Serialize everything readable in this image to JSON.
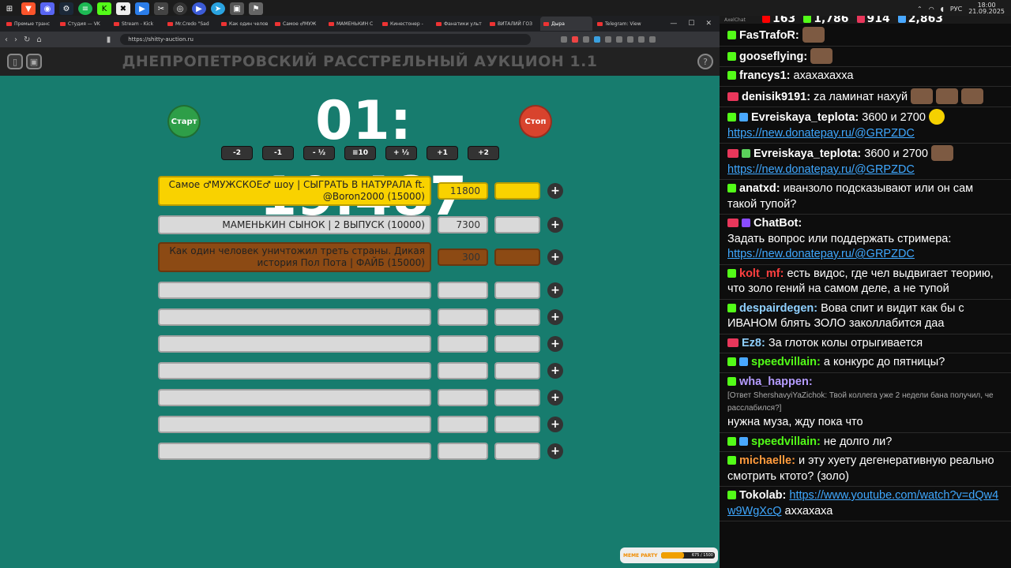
{
  "taskbar": {
    "lang": "РУС",
    "time": "18:00",
    "date": "21.09.2025"
  },
  "browser": {
    "tabs": [
      {
        "label": "Премые транс"
      },
      {
        "label": "Студия — VK"
      },
      {
        "label": "Stream - Kick"
      },
      {
        "label": "Mr.Credo \"Sad"
      },
      {
        "label": "Как один челов"
      },
      {
        "label": "Самое ♂МУЖ"
      },
      {
        "label": "МАМЕНЬКИН С"
      },
      {
        "label": "Кинестонер -"
      },
      {
        "label": "Фанатики ульт"
      },
      {
        "label": "ВИТАЛИЙ ГОЗ"
      },
      {
        "label": "Дыра",
        "active": true
      },
      {
        "label": "Telegram: View"
      }
    ],
    "url": "https://shitty-auction.ru"
  },
  "auction": {
    "title": "ДНЕПРОПЕТРОВСКИЙ РАССТРЕЛЬНЫЙ АУКЦИОН 1.1",
    "start_label": "Старт",
    "stop_label": "Стоп",
    "timer": "01: 19.487",
    "help": "?",
    "adjust": [
      "-2",
      "-1",
      "- ½",
      "≡10",
      "+ ½",
      "+1",
      "+2"
    ],
    "lots": [
      {
        "name": "Самое ♂МУЖСКОЕ♂ шоу | СЫГРАТЬ В НАТУРАЛА ft. @Boron2000 (15000)",
        "amount": "11800",
        "color": "yellow"
      },
      {
        "name": "МАМЕНЬКИН СЫНОК | 2 ВЫПУСК (10000)",
        "amount": "7300",
        "color": "gray"
      },
      {
        "name": "Как один человек уничтожил треть страны. Дикая история Пол Пота | ФАЙБ (15000)",
        "amount": "300",
        "color": "brown"
      },
      {
        "name": "",
        "amount": "",
        "color": "gray"
      },
      {
        "name": "",
        "amount": "",
        "color": "gray"
      },
      {
        "name": "",
        "amount": "",
        "color": "gray"
      },
      {
        "name": "",
        "amount": "",
        "color": "gray"
      },
      {
        "name": "",
        "amount": "",
        "color": "gray"
      },
      {
        "name": "",
        "amount": "",
        "color": "gray"
      },
      {
        "name": "",
        "amount": "",
        "color": "gray"
      }
    ],
    "plus_label": "+"
  },
  "widget": {
    "label": "MEME PARTY",
    "progress_text": "675 / 1500",
    "progress_fraction": 0.45
  },
  "chat": {
    "app_name": "AxelChat",
    "stats": [
      {
        "value": "163",
        "color": "#ff0000"
      },
      {
        "value": "1,786",
        "color": "#53fc18"
      },
      {
        "value": "914",
        "color": "#e8375b"
      },
      {
        "value": "2,863",
        "color": "#49a8ff"
      }
    ],
    "messages": [
      {
        "badges": [
          "k"
        ],
        "user": "FasTrafoR:",
        "color": "#ffffff",
        "text": "",
        "emotes": 1
      },
      {
        "badges": [
          "k"
        ],
        "user": "gooseflying:",
        "color": "#ffffff",
        "text": "",
        "emotes": 1
      },
      {
        "badges": [
          "k"
        ],
        "user": "francys1:",
        "color": "#ffffff",
        "text": "ахахахахха"
      },
      {
        "badges": [
          "live"
        ],
        "user": "denisik9191:",
        "color": "#ffffff",
        "text": "za ламинат нахуй",
        "emotes": 3
      },
      {
        "badges": [
          "k",
          "sword"
        ],
        "user": "Evreiskaya_teplota:",
        "color": "#ffffff",
        "text": "3600 и 2700",
        "emotes_yellow": 1,
        "link": "https://new.donatepay.ru/@GRPZDC"
      },
      {
        "badges": [
          "live",
          "pen"
        ],
        "user": "Evreiskaya_teplota:",
        "color": "#ffffff",
        "text": "3600 и 2700",
        "emotes": 1,
        "link": "https://new.donatepay.ru/@GRPZDC"
      },
      {
        "badges": [
          "k"
        ],
        "user": "anatxd:",
        "color": "#ffffff",
        "text": "иванзоло подсказывают или он сам такой тупой?"
      },
      {
        "badges": [
          "live",
          "bot"
        ],
        "user": "ChatBot:",
        "color": "#ffffff",
        "text": "Задать вопрос или поддержать стримера:",
        "link": "https://new.donatepay.ru/@GRPZDC",
        "block": true
      },
      {
        "badges": [
          "k"
        ],
        "user": "kolt_mf:",
        "color": "#ff4040",
        "text": "есть видос, где чел выдвигает теорию, что золо гений на самом деле, а не тупой"
      },
      {
        "badges": [
          "k"
        ],
        "user": "despairdegen:",
        "color": "#8fd0ff",
        "text": "Вова спит и видит как бы с ИВАНОМ блять ЗОЛО заколлабится даа"
      },
      {
        "badges": [
          "live"
        ],
        "user": "Ez8:",
        "color": "#8fd0ff",
        "text": "За глоток колы отрыгивается"
      },
      {
        "badges": [
          "k",
          "sword"
        ],
        "user": "speedvillain:",
        "color": "#53fc18",
        "text": "а конкурс до пятницы?"
      },
      {
        "badges": [
          "k"
        ],
        "user": "wha_happen:",
        "color": "#b59cff",
        "text": "",
        "reply": "[Ответ ShershavyiYaZichok: Твой коллега уже 2 недели бана получил, че расслабился?]",
        "after": "нужна муза, жду пока что"
      },
      {
        "badges": [
          "k",
          "sword"
        ],
        "user": "speedvillain:",
        "color": "#53fc18",
        "text": "не долго ли?"
      },
      {
        "badges": [
          "k"
        ],
        "user": "michaelle:",
        "color": "#ff9a3c",
        "text": "и эту хуету дегенеративную реально смотрить ктото? (золо)"
      },
      {
        "badges": [
          "k"
        ],
        "user": "Tokolab:",
        "color": "#ffffff",
        "text": "",
        "link": "https://www.youtube.com/watch?v=dQw4w9WgXcQ",
        "after_inline": " аххахаха"
      }
    ]
  }
}
